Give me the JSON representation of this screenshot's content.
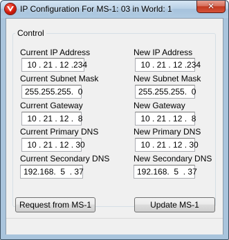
{
  "window": {
    "title": "IP Configuration For MS-1: 03 in World: 1",
    "close_glyph": "✕"
  },
  "group": {
    "title": "Control"
  },
  "fields": {
    "current_ip": {
      "label": "Current IP Address",
      "value": " 10 . 21 . 12 .234"
    },
    "new_ip": {
      "label": "New IP Address",
      "value": " 10 . 21 . 12 .234"
    },
    "current_subnet": {
      "label": "Current Subnet Mask",
      "value": "255.255.255.  0"
    },
    "new_subnet": {
      "label": "New Subnet Mask",
      "value": "255.255.255.  0"
    },
    "current_gateway": {
      "label": "Current Gateway",
      "value": " 10 . 21 . 12 .  8"
    },
    "new_gateway": {
      "label": "New Gateway",
      "value": " 10 . 21 . 12 .  8"
    },
    "current_pdns": {
      "label": "Current Primary DNS",
      "value": " 10 . 21 . 12 . 30"
    },
    "new_pdns": {
      "label": "New Primary DNS",
      "value": " 10 . 21 . 12 . 30"
    },
    "current_sdns": {
      "label": "Current Secondary DNS",
      "value": "192.168.  5  . 37"
    },
    "new_sdns": {
      "label": "New Secondary DNS",
      "value": "192.168.  5  . 37"
    }
  },
  "buttons": {
    "request": "Request from MS-1",
    "update": "Update MS-1"
  },
  "colors": {
    "title_frame": "#a9c4dc",
    "close_button": "#c2391f",
    "client_bg": "#f0f0f0"
  }
}
